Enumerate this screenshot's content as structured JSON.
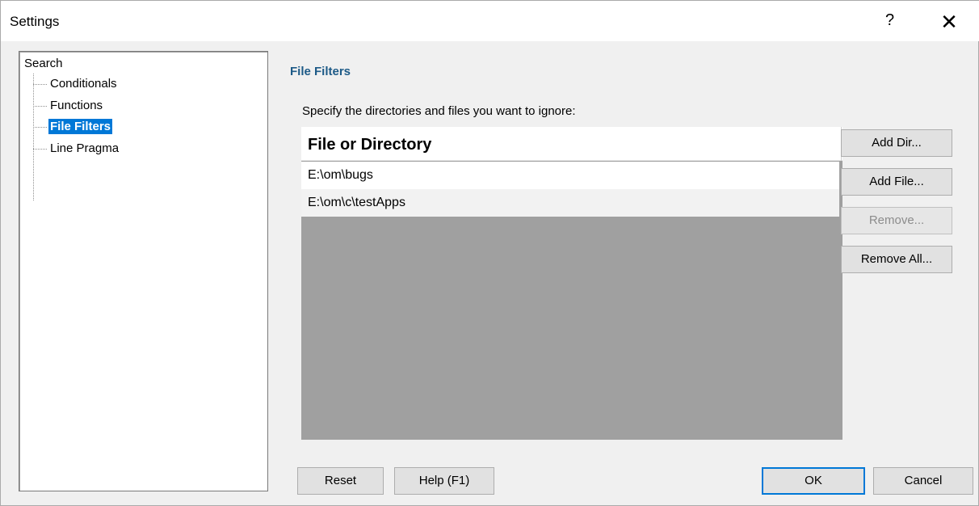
{
  "window": {
    "title": "Settings",
    "help_label": "?",
    "close_label": "✕"
  },
  "tree": {
    "root": "Search",
    "items": [
      {
        "label": "Conditionals"
      },
      {
        "label": "Functions"
      },
      {
        "label": "File Filters",
        "selected": true
      },
      {
        "label": "Line Pragma"
      }
    ]
  },
  "panel": {
    "title": "File Filters",
    "instruction": "Specify the directories and files you want to ignore:",
    "list": {
      "column_header": "File or Directory",
      "rows": [
        "E:\\om\\bugs",
        "E:\\om\\c\\testApps"
      ]
    },
    "buttons": {
      "add_dir": "Add Dir...",
      "add_file": "Add File...",
      "remove": "Remove...",
      "remove_all": "Remove All..."
    }
  },
  "footer": {
    "reset": "Reset",
    "help": "Help (F1)",
    "ok": "OK",
    "cancel": "Cancel"
  }
}
